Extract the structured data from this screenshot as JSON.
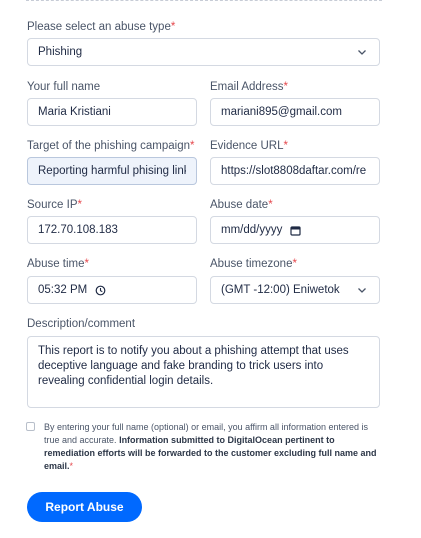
{
  "abuse_type": {
    "label": "Please select an abuse type",
    "required_mark": "*",
    "value": "Phishing"
  },
  "full_name": {
    "label": "Your full name",
    "value": "Maria Kristiani"
  },
  "email": {
    "label": "Email Address",
    "required_mark": "*",
    "value": "mariani895@gmail.com"
  },
  "target": {
    "label": "Target of the phishing campaign",
    "required_mark": "*",
    "value": "Reporting harmful phising link"
  },
  "evidence_url": {
    "label": "Evidence URL",
    "required_mark": "*",
    "value": "https://slot8808daftar.com/re"
  },
  "source_ip": {
    "label": "Source IP",
    "required_mark": "*",
    "value": "172.70.108.183"
  },
  "abuse_date": {
    "label": "Abuse date",
    "required_mark": "*",
    "value": "mm/dd/yyyy"
  },
  "abuse_time": {
    "label": "Abuse time",
    "required_mark": "*",
    "value": "05:32 PM"
  },
  "abuse_timezone": {
    "label": "Abuse timezone",
    "required_mark": "*",
    "value": "(GMT -12:00) Eniwetok"
  },
  "description": {
    "label": "Description/comment",
    "value": "This report is to notify you about a phishing attempt that uses deceptive language and fake branding to trick users into revealing confidential login details."
  },
  "consent": {
    "text": "By entering your full name (optional) or email, you affirm all information entered is true and accurate.",
    "bold_text": "Information submitted to DigitalOcean pertinent to remediation efforts will be forwarded to the customer excluding full name and email.",
    "required_mark": "*",
    "checked": false
  },
  "submit_label": "Report Abuse",
  "colors": {
    "accent": "#0069ff",
    "required": "#e5484d"
  }
}
